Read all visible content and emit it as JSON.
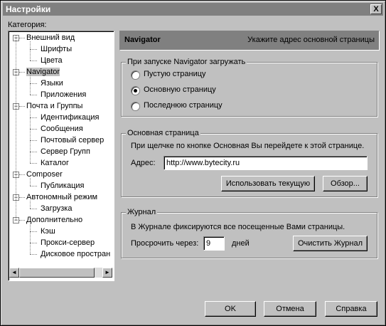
{
  "window": {
    "title": "Настройки",
    "close_label": "X"
  },
  "category_label": "Категория:",
  "tree": {
    "items": [
      {
        "label": "Внешний вид",
        "level": 0,
        "expander": "−"
      },
      {
        "label": "Шрифты",
        "level": 1
      },
      {
        "label": "Цвета",
        "level": 1
      },
      {
        "label": "Navigator",
        "level": 0,
        "expander": "−",
        "selected": true
      },
      {
        "label": "Языки",
        "level": 1
      },
      {
        "label": "Приложения",
        "level": 1
      },
      {
        "label": "Почта и Группы",
        "level": 0,
        "expander": "−"
      },
      {
        "label": "Идентификация",
        "level": 1
      },
      {
        "label": "Сообщения",
        "level": 1
      },
      {
        "label": "Почтовый сервер",
        "level": 1
      },
      {
        "label": "Сервер Групп",
        "level": 1
      },
      {
        "label": "Каталог",
        "level": 1
      },
      {
        "label": "Composer",
        "level": 0,
        "expander": "−"
      },
      {
        "label": "Публикация",
        "level": 1
      },
      {
        "label": "Автономный режим",
        "level": 0,
        "expander": "−"
      },
      {
        "label": "Загрузка",
        "level": 1
      },
      {
        "label": "Дополнительно",
        "level": 0,
        "expander": "−"
      },
      {
        "label": "Кэш",
        "level": 1
      },
      {
        "label": "Прокси-сервер",
        "level": 1
      },
      {
        "label": "Дисковое простран",
        "level": 1
      }
    ],
    "scroll_left": "◄",
    "scroll_right": "►"
  },
  "header": {
    "title": "Navigator",
    "description": "Укажите адрес основной страницы"
  },
  "startup": {
    "legend": "При запуске Navigator загружать",
    "options": [
      {
        "label": "Пустую страницу",
        "checked": false
      },
      {
        "label": "Основную страницу",
        "checked": true
      },
      {
        "label": "Последнюю страницу",
        "checked": false
      }
    ]
  },
  "homepage": {
    "legend": "Основная страница",
    "hint": "При щелчке по кнопке Основная Вы перейдете к этой странице.",
    "address_label": "Адрес:",
    "address_value": "http://www.bytecity.ru",
    "use_current_label": "Использовать текущую",
    "browse_label": "Обзор..."
  },
  "history": {
    "legend": "Журнал",
    "hint": "В Журнале фиксируются все посещенные Вами страницы.",
    "expire_label": "Просрочить через:",
    "expire_value": "9",
    "days_label": "дней",
    "clear_label": "Очистить Журнал"
  },
  "footer": {
    "ok_label": "OK",
    "cancel_label": "Отмена",
    "help_label": "Справка"
  }
}
